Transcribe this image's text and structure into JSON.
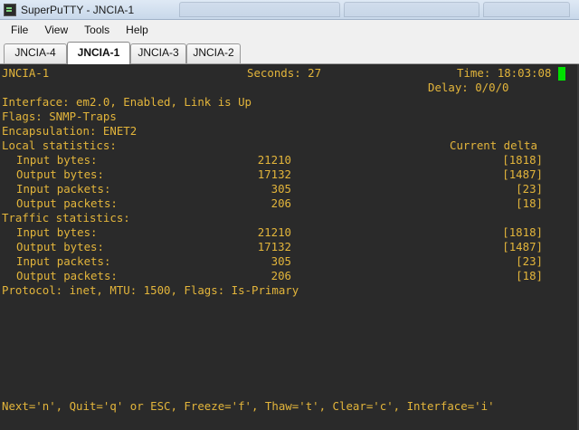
{
  "window": {
    "title": "SuperPuTTY - JNCIA-1"
  },
  "menu": [
    "File",
    "View",
    "Tools",
    "Help"
  ],
  "tabs": [
    "JNCIA-4",
    "JNCIA-1",
    "JNCIA-3",
    "JNCIA-2"
  ],
  "active_tab_index": 1,
  "terminal": {
    "host": "JNCIA-1",
    "seconds_label": "Seconds: 27",
    "time_label": "Time: 18:03:08",
    "delay_label": "Delay: 0/0/0",
    "interface_line": "Interface: em2.0, Enabled, Link is Up",
    "flags_line": "Flags: SNMP-Traps",
    "encapsulation_line": "Encapsulation: ENET2",
    "local_header": "Local statistics:",
    "delta_header": "Current delta",
    "local_rows": [
      {
        "label": "Input bytes:",
        "value": "21210",
        "delta": "[1818]"
      },
      {
        "label": "Output bytes:",
        "value": "17132",
        "delta": "[1487]"
      },
      {
        "label": "Input packets:",
        "value": "305",
        "delta": "[23]"
      },
      {
        "label": "Output packets:",
        "value": "206",
        "delta": "[18]"
      }
    ],
    "traffic_header": "Traffic statistics:",
    "traffic_rows": [
      {
        "label": "Input bytes:",
        "value": "21210",
        "delta": "[1818]"
      },
      {
        "label": "Output bytes:",
        "value": "17132",
        "delta": "[1487]"
      },
      {
        "label": "Input packets:",
        "value": "305",
        "delta": "[23]"
      },
      {
        "label": "Output packets:",
        "value": "206",
        "delta": "[18]"
      }
    ],
    "protocol_line": "Protocol: inet, MTU: 1500, Flags: Is-Primary",
    "help_line": "Next='n', Quit='q' or ESC, Freeze='f', Thaw='t', Clear='c', Interface='i'"
  },
  "colors": {
    "terminal_bg": "#2a2a2a",
    "terminal_fg": "#e3b53b",
    "cursor": "#00e000"
  }
}
